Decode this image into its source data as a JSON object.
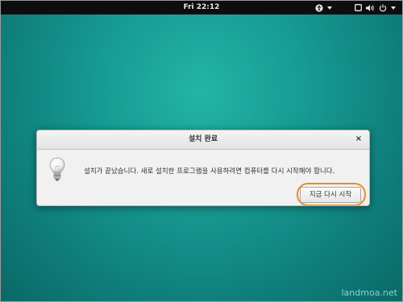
{
  "topbar": {
    "clock": "Fri 22:12",
    "icons": [
      "accessibility-icon",
      "chevron-down-icon",
      "window-icon",
      "volume-icon",
      "power-icon",
      "chevron-down-icon"
    ]
  },
  "dialog": {
    "title": "설치 완료",
    "close_label": "×",
    "message": "설치가 끝났습니다. 새로 설치한 프로그램을 사용하려면 컴퓨터를 다시 시작해야 합니다.",
    "icon": "lightbulb-icon",
    "restart_label": "지금 다시 시작"
  },
  "watermark": "landmoa.net",
  "colors": {
    "desktop": "#179c93",
    "highlight": "#f08a24"
  }
}
